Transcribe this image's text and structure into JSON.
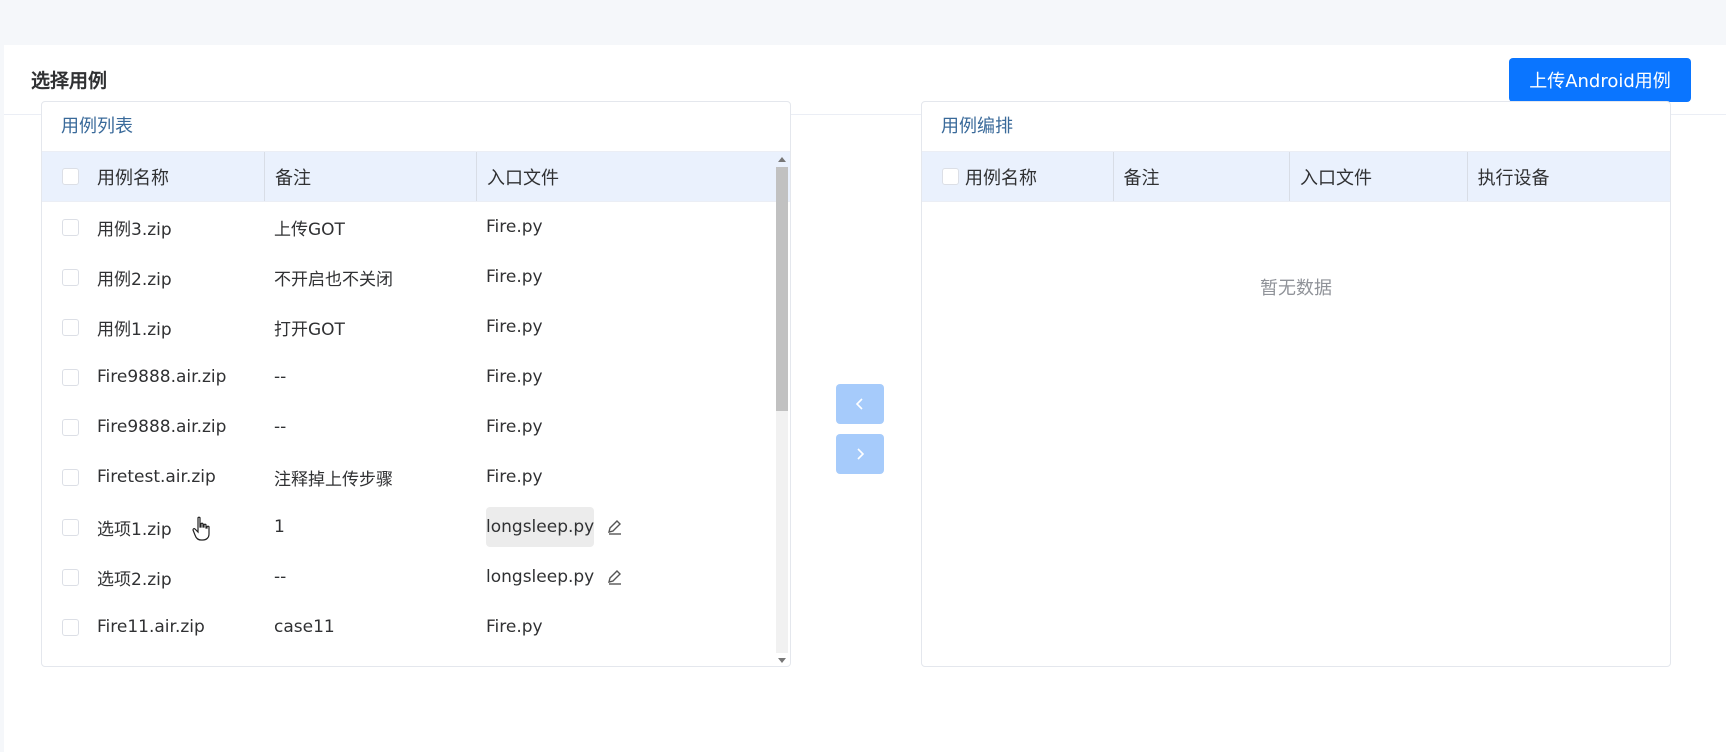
{
  "header": {
    "title": "选择用例",
    "upload_button": "上传Android用例"
  },
  "left_panel": {
    "title": "用例列表",
    "columns": [
      "用例名称",
      "备注",
      "入口文件"
    ],
    "rows": [
      {
        "name": "用例3.zip",
        "note": "上传GOT",
        "file": "Fire.py"
      },
      {
        "name": "用例2.zip",
        "note": "不开启也不关闭",
        "file": "Fire.py"
      },
      {
        "name": "用例1.zip",
        "note": "打开GOT",
        "file": "Fire.py"
      },
      {
        "name": "Fire9888.air.zip",
        "note": "--",
        "file": "Fire.py"
      },
      {
        "name": "Fire9888.air.zip",
        "note": "--",
        "file": "Fire.py"
      },
      {
        "name": "Firetest.air.zip",
        "note": "注释掉上传步骤",
        "file": "Fire.py"
      },
      {
        "name": "选项1.zip",
        "note": "1",
        "file": "longsleep.py"
      },
      {
        "name": "选项2.zip",
        "note": "--",
        "file": "longsleep.py"
      },
      {
        "name": "Fire11.air.zip",
        "note": "case11",
        "file": "Fire.py"
      }
    ]
  },
  "right_panel": {
    "title": "用例编排",
    "columns": [
      "用例名称",
      "备注",
      "入口文件",
      "执行设备"
    ],
    "empty_text": "暂无数据"
  },
  "colors": {
    "primary": "#0a75ff",
    "transfer_button": "#a6cbfb",
    "header_bg": "#eaf1fd"
  },
  "icons": {
    "transfer_left": "chevron-left-icon",
    "transfer_right": "chevron-right-icon",
    "edit": "pencil-icon"
  }
}
